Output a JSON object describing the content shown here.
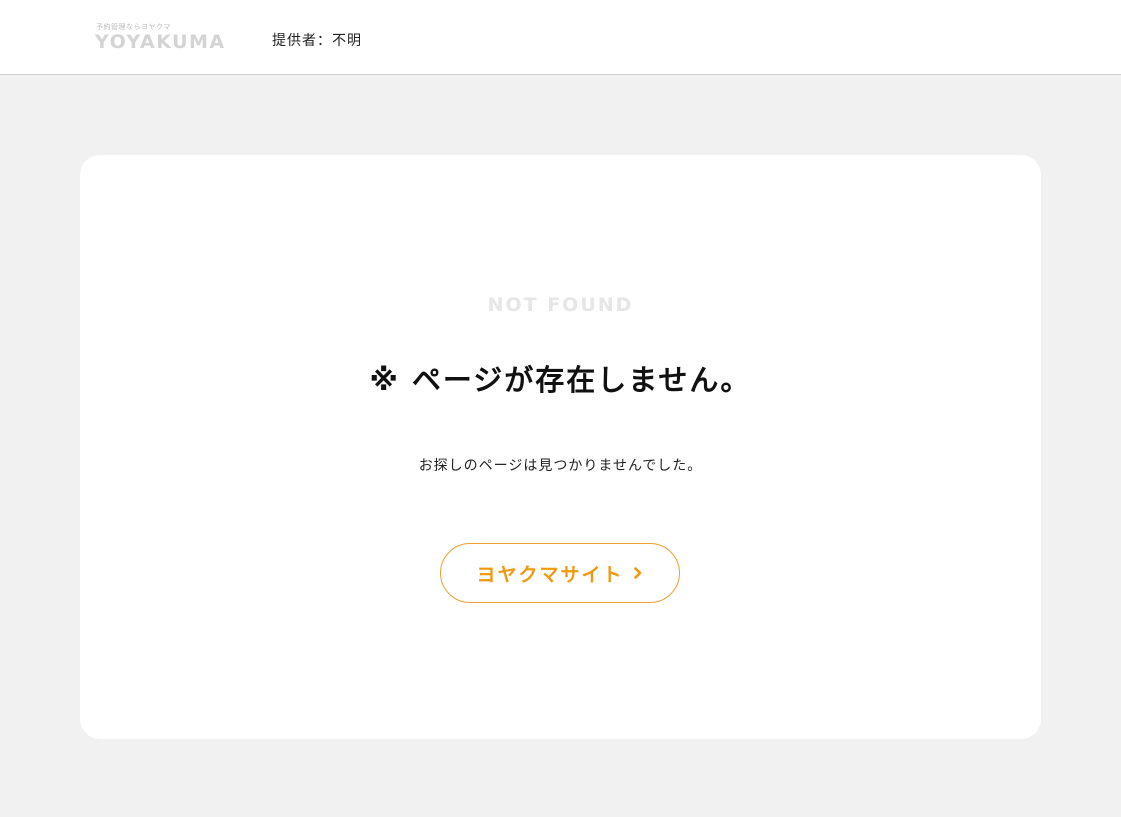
{
  "header": {
    "logo": {
      "tagline": "予約管理ならヨヤクマ",
      "wordmark": "YOYAKUMA"
    },
    "provider_text": "提供者：不明"
  },
  "main": {
    "eyebrow": "NOT FOUND",
    "title": "※ ページが存在しません。",
    "message": "お探しのページは見つかりませんでした。",
    "button": {
      "label": "ヨヤクマサイト",
      "icon": "chevron-right-icon"
    }
  },
  "colors": {
    "accent": "#f0980f",
    "page_background": "#f1f1f1",
    "card_background": "#ffffff"
  }
}
